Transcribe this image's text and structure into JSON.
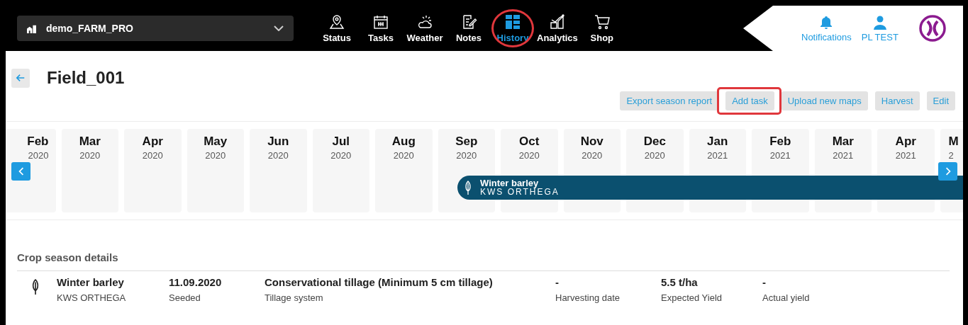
{
  "farm_selector": {
    "value": "demo_FARM_PRO"
  },
  "nav": [
    {
      "label": "Status",
      "selected": false,
      "highlighted": false
    },
    {
      "label": "Tasks",
      "selected": false,
      "highlighted": false
    },
    {
      "label": "Weather",
      "selected": false,
      "highlighted": false
    },
    {
      "label": "Notes",
      "selected": false,
      "highlighted": false
    },
    {
      "label": "History",
      "selected": true,
      "highlighted": true
    },
    {
      "label": "Analytics",
      "selected": false,
      "highlighted": false
    },
    {
      "label": "Shop",
      "selected": false,
      "highlighted": false
    }
  ],
  "user_menu": [
    {
      "label": "Notifications"
    },
    {
      "label": "PL TEST"
    }
  ],
  "field": {
    "title": "Field_001"
  },
  "actions": [
    {
      "label": "Export season report",
      "highlighted": false
    },
    {
      "label": "Add task",
      "highlighted": true
    },
    {
      "label": "Upload new maps",
      "highlighted": false
    },
    {
      "label": "Harvest",
      "highlighted": false
    },
    {
      "label": "Edit",
      "highlighted": false
    }
  ],
  "timeline": {
    "months": [
      {
        "month": "Feb",
        "year": "2020"
      },
      {
        "month": "Mar",
        "year": "2020"
      },
      {
        "month": "Apr",
        "year": "2020"
      },
      {
        "month": "May",
        "year": "2020"
      },
      {
        "month": "Jun",
        "year": "2020"
      },
      {
        "month": "Jul",
        "year": "2020"
      },
      {
        "month": "Aug",
        "year": "2020"
      },
      {
        "month": "Sep",
        "year": "2020"
      },
      {
        "month": "Oct",
        "year": "2020"
      },
      {
        "month": "Nov",
        "year": "2020"
      },
      {
        "month": "Dec",
        "year": "2020"
      },
      {
        "month": "Jan",
        "year": "2021"
      },
      {
        "month": "Feb",
        "year": "2021"
      },
      {
        "month": "Mar",
        "year": "2021"
      },
      {
        "month": "Apr",
        "year": "2021"
      },
      {
        "month": "M",
        "year": "2"
      }
    ],
    "crop_bar": {
      "crop": "Winter barley",
      "variety": "KWS ORTHEGA"
    }
  },
  "crop_season_details": {
    "title": "Crop season details",
    "row": {
      "crop": "Winter barley",
      "variety": "KWS ORTHEGA",
      "fields": [
        {
          "value": "11.09.2020",
          "label": "Seeded"
        },
        {
          "value": "Conservational tillage (Minimum 5 cm tillage)",
          "label": "Tillage system"
        },
        {
          "value": "-",
          "label": "Harvesting date"
        },
        {
          "value": "5.5 t/ha",
          "label": "Expected Yield"
        },
        {
          "value": "-",
          "label": "Actual yield"
        }
      ]
    }
  }
}
